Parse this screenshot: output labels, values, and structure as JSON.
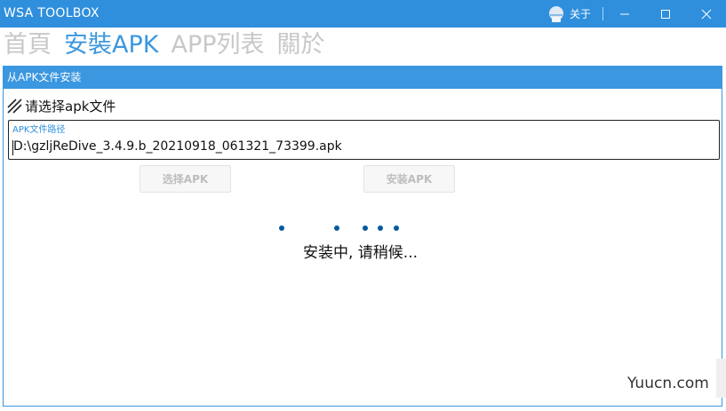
{
  "window": {
    "title": "WSA TOOLBOX",
    "about_label": "关于",
    "icons": [
      "about-icon",
      "minimize-icon",
      "maximize-icon",
      "close-icon"
    ],
    "accent_color": "#2f8fdc"
  },
  "nav": {
    "items": [
      {
        "label": "首頁",
        "active": false
      },
      {
        "label": "安裝APK",
        "active": true
      },
      {
        "label": "APP列表",
        "active": false
      },
      {
        "label": "關於",
        "active": false
      }
    ]
  },
  "panel": {
    "header": "从APK文件安装",
    "section_title": "请选择apk文件",
    "path_field": {
      "label": "APK文件路径",
      "value": "D:\\gzljReDive_3.4.9.b_20210918_061321_73399.apk"
    },
    "choose_button": "选择APK",
    "install_button": "安装APK",
    "status": "安装中, 请稍候..."
  },
  "watermark": "Yuucn.com"
}
